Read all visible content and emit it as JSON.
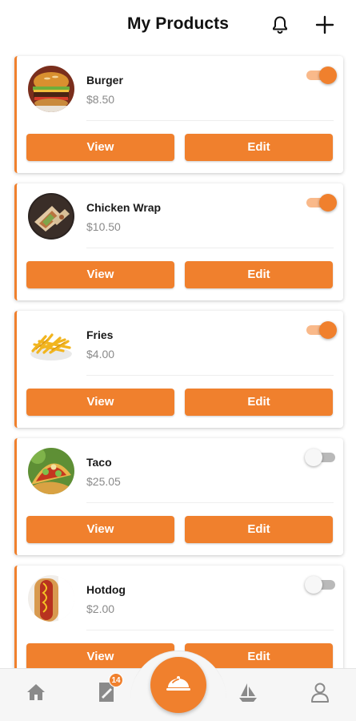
{
  "header": {
    "title": "My Products",
    "notification_icon": "bell-icon",
    "add_icon": "plus-icon"
  },
  "colors": {
    "accent": "#f0802d",
    "toggle_track_on": "#f9b98a",
    "toggle_track_off": "#b9b9b9",
    "price_text": "#8a8a8a"
  },
  "products": [
    {
      "name": "Burger",
      "price": "$8.50",
      "active": true,
      "image": "burger-image",
      "view_label": "View",
      "edit_label": "Edit"
    },
    {
      "name": "Chicken Wrap",
      "price": "$10.50",
      "active": true,
      "image": "chicken-wrap-image",
      "view_label": "View",
      "edit_label": "Edit"
    },
    {
      "name": "Fries",
      "price": "$4.00",
      "active": true,
      "image": "fries-image",
      "view_label": "View",
      "edit_label": "Edit"
    },
    {
      "name": "Taco",
      "price": "$25.05",
      "active": false,
      "image": "taco-image",
      "view_label": "View",
      "edit_label": "Edit"
    },
    {
      "name": "Hotdog",
      "price": "$2.00",
      "active": false,
      "image": "hotdog-image",
      "view_label": "View",
      "edit_label": "Edit"
    }
  ],
  "bottom_nav": {
    "items": [
      {
        "icon": "home-icon"
      },
      {
        "icon": "orders-icon",
        "badge": "14"
      },
      {
        "icon": "food-cover-icon"
      },
      {
        "icon": "boat-icon"
      },
      {
        "icon": "profile-icon"
      }
    ]
  }
}
